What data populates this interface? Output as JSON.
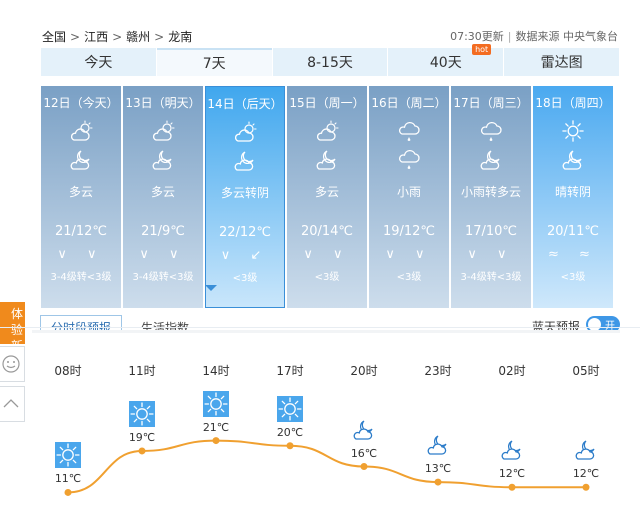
{
  "breadcrumb": {
    "items": [
      "全国",
      "江西",
      "赣州",
      "龙南"
    ],
    "sep": ">"
  },
  "source": {
    "update": "07:30更新",
    "label": "数据来源 中央气象台"
  },
  "tabs": [
    {
      "label": "今天"
    },
    {
      "label": "7天"
    },
    {
      "label": "8-15天"
    },
    {
      "label": "40天",
      "badge": "hot"
    },
    {
      "label": "雷达图"
    }
  ],
  "days": [
    {
      "date": "12日（今天）",
      "desc": "多云",
      "temp": "21/12℃",
      "wind": "3-4级转<3级",
      "icon1": "partly-cloudy-icon",
      "icon2": "cloudy-night-icon"
    },
    {
      "date": "13日（明天）",
      "desc": "多云",
      "temp": "21/9℃",
      "wind": "3-4级转<3级",
      "icon1": "partly-cloudy-icon",
      "icon2": "cloudy-night-icon"
    },
    {
      "date": "14日（后天）",
      "desc": "多云转阴",
      "temp": "22/12℃",
      "wind": "<3级",
      "icon1": "partly-cloudy-icon",
      "icon2": "cloudy-night-icon"
    },
    {
      "date": "15日（周一）",
      "desc": "多云",
      "temp": "20/14℃",
      "wind": "<3级",
      "icon1": "partly-cloudy-icon",
      "icon2": "cloudy-night-icon"
    },
    {
      "date": "16日（周二）",
      "desc": "小雨",
      "temp": "19/12℃",
      "wind": "<3级",
      "icon1": "rain-icon",
      "icon2": "rain-icon"
    },
    {
      "date": "17日（周三）",
      "desc": "小雨转多云",
      "temp": "17/10℃",
      "wind": "3-4级转<3级",
      "icon1": "rain-icon",
      "icon2": "cloudy-night-icon"
    },
    {
      "date": "18日（周四）",
      "desc": "晴转阴",
      "temp": "20/11℃",
      "wind": "<3级",
      "icon1": "sun-icon",
      "icon2": "cloudy-night-icon"
    }
  ],
  "subtabs": {
    "active": "分时段预报",
    "other": "生活指数"
  },
  "bluesky": {
    "label": "蓝天预报",
    "toggle": "开"
  },
  "sidebar": {
    "badge": "体验新版"
  },
  "hourly": [
    {
      "time": "08时",
      "temp": "11℃",
      "value": 11,
      "icon": "sun-icon"
    },
    {
      "time": "11时",
      "temp": "19℃",
      "value": 19,
      "icon": "sun-icon"
    },
    {
      "time": "14时",
      "temp": "21℃",
      "value": 21,
      "icon": "sun-icon"
    },
    {
      "time": "17时",
      "temp": "20℃",
      "value": 20,
      "icon": "sun-icon"
    },
    {
      "time": "20时",
      "temp": "16℃",
      "value": 16,
      "icon": "cloudy-night-icon"
    },
    {
      "time": "23时",
      "temp": "13℃",
      "value": 13,
      "icon": "cloudy-night-icon"
    },
    {
      "time": "02时",
      "temp": "12℃",
      "value": 12,
      "icon": "cloudy-night-icon"
    },
    {
      "time": "05时",
      "temp": "12℃",
      "value": 12,
      "icon": "cloudy-night-icon"
    }
  ],
  "colors": {
    "accent": "#3e97e6",
    "curve": "#f0a030",
    "badge": "#f08a1c"
  }
}
